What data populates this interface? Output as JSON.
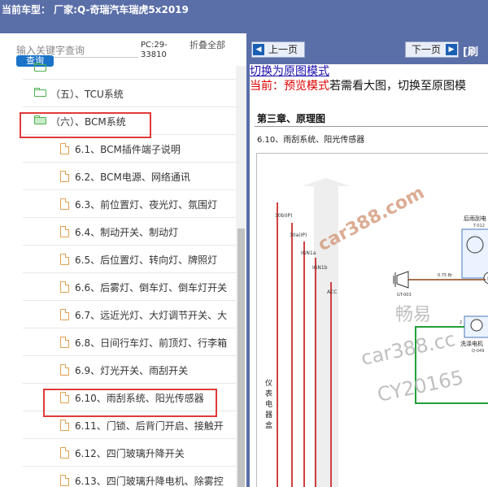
{
  "titlebar": {
    "title": "当前车型： 厂家:Q-奇瑞汽车瑞虎5x2019"
  },
  "sidebar": {
    "search_placeholder": "输入关键字查询",
    "search_button": "查询",
    "pc_code": "PC:29-33810",
    "fold_all": "折叠全部",
    "folders": [
      {
        "label": "（五）、TCU系统",
        "open": false
      },
      {
        "label": "（六）、BCM系统",
        "open": true
      }
    ],
    "items": [
      "6.1、BCM插件端子说明",
      "6.2、BCM电源、网络通讯",
      "6.3、前位置灯、夜光灯、氛围灯",
      "6.4、制动开关、制动灯",
      "6.5、后位置灯、转向灯、牌照灯",
      "6.6、后雾灯、倒车灯、倒车灯开关",
      "6.7、远近光灯、大灯调节开关、大",
      "6.8、日间行车灯、前顶灯、行李箱",
      "6.9、灯光开关、雨刮开关",
      "6.10、雨刮系统、阳光传感器",
      "6.11、门锁、后背门开启、接触开",
      "6.12、四门玻璃升降开关",
      "6.13、四门玻璃升降电机、除雾控"
    ]
  },
  "viewer": {
    "prev_label": "上一页",
    "next_label": "下一页",
    "refresh_label": "[刷",
    "switch_link": "切换为原图模式",
    "preview_prefix": "当前：预览模式",
    "preview_suffix": "若需看大图，切换至原图模",
    "chapter": "第三章、原理图",
    "section": "6.10、雨刮系统、阳光传感器",
    "diagram": {
      "box_label": "仪表电器盒",
      "labels": [
        "30b(IP)",
        "30a(IP)",
        "IGN1a",
        "IGN1b",
        "ACC",
        "后雨刮电",
        "T-012",
        "0.75 Br",
        "GT-003",
        "洗涤电机",
        "Q-049",
        "2",
        "M"
      ],
      "watermark": [
        "car388.com",
        "畅易",
        "car388.cc",
        "CY20165"
      ]
    }
  },
  "colors": {
    "titlebar": "#5a6ea8",
    "highlight": "#e03a3a",
    "folder": "#4caf50",
    "doc_icon": "#e0a050",
    "wire_red": "#d04040",
    "wire_green": "#22a03a",
    "watermark": "#c0c0c0"
  }
}
